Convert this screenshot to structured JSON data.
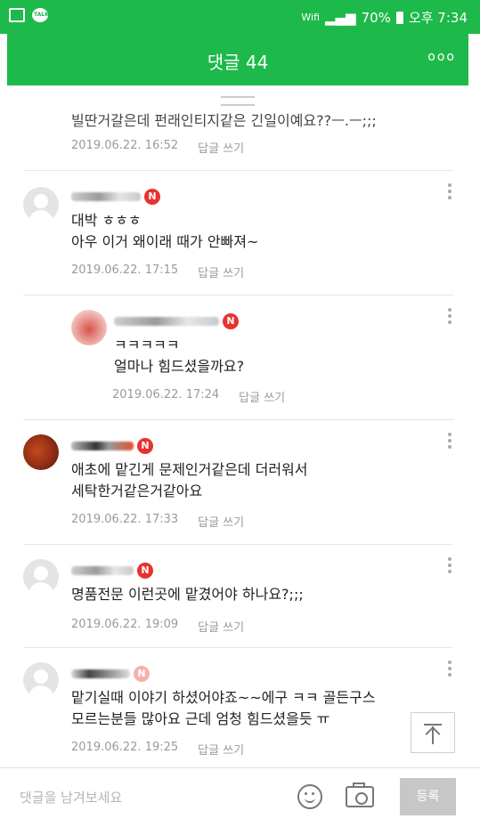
{
  "status_bar": {
    "battery": "70%",
    "time": "오후 7:34",
    "carrier": "Wifi"
  },
  "header": {
    "title": "댓글 44",
    "more_label": "ooo"
  },
  "comments": [
    {
      "body": "빌딴거갈은데 펀래인티지같은 긴일이예요??ㅡ.ㅡ;;;",
      "date": "2019.06.22. 16:52",
      "reply": "답글 쓰기"
    },
    {
      "body": "대박 ㅎㅎㅎ\n아우 이거 왜이래 때가 안빠져~",
      "date": "2019.06.22. 17:15",
      "reply": "답글 쓰기"
    },
    {
      "body": "ㅋㅋㅋㅋㅋ\n얼마나 힘드셨을까요?",
      "date": "2019.06.22. 17:24",
      "reply": "답글 쓰기"
    },
    {
      "body": "애초에 맡긴게 문제인거같은데 더러워서\n세탁한거같은거같아요",
      "date": "2019.06.22. 17:33",
      "reply": "답글 쓰기"
    },
    {
      "body": "명품전문 이런곳에 맡겼어야 하나요?;;;",
      "date": "2019.06.22. 19:09",
      "reply": "답글 쓰기"
    },
    {
      "body": "맡기실때 이야기 하셨어야죠~~에구 ㅋㅋ 골든구스\n모르는분들 많아요 근데 엄청 힘드셨을듯 ㅠ",
      "date": "2019.06.22. 19:25",
      "reply": "답글 쓰기"
    }
  ],
  "badge_letter": "N",
  "input": {
    "placeholder": "댓글을 남겨보세요",
    "submit_label": "등록"
  }
}
